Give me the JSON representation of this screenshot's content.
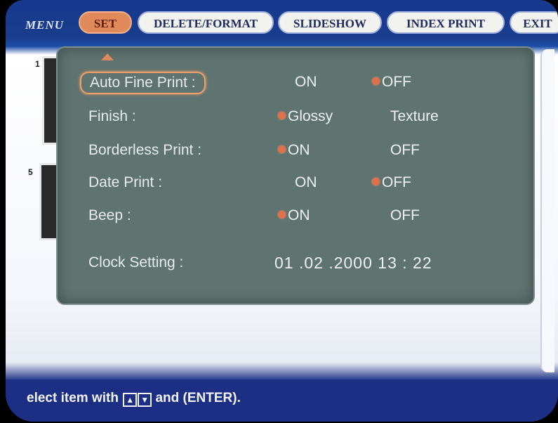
{
  "menu": {
    "label": "MENU",
    "tabs": [
      {
        "label": "SET",
        "active": true
      },
      {
        "label": "DELETE/FORMAT",
        "active": false
      },
      {
        "label": "SLIDESHOW",
        "active": false
      },
      {
        "label": "INDEX PRINT",
        "active": false
      },
      {
        "label": "EXIT",
        "active": false
      }
    ]
  },
  "thumbnails": [
    "1",
    "5"
  ],
  "settings": {
    "rows": [
      {
        "label": "Auto Fine Print :",
        "options": [
          "ON",
          "OFF"
        ],
        "selected": "OFF"
      },
      {
        "label": "Finish :",
        "options": [
          "Glossy",
          "Texture"
        ],
        "selected": "Glossy"
      },
      {
        "label": "Borderless Print :",
        "options": [
          "ON",
          "OFF"
        ],
        "selected": "ON"
      },
      {
        "label": "Date Print :",
        "options": [
          "ON",
          "OFF"
        ],
        "selected": "OFF"
      },
      {
        "label": "Beep :",
        "options": [
          "ON",
          "OFF"
        ],
        "selected": "ON"
      }
    ],
    "clock": {
      "label": "Clock Setting :",
      "value": "01 .02 .2000  13 : 22"
    }
  },
  "status": {
    "text_before": "elect item with",
    "text_after": "and (ENTER).",
    "up_icon": "up-arrow-key-icon",
    "down_icon": "down-arrow-key-icon"
  },
  "colors": {
    "accent": "#e08a5b",
    "panel": "#5f7370",
    "bar": "#1c2f84",
    "selected_dot": "#e0704a"
  }
}
